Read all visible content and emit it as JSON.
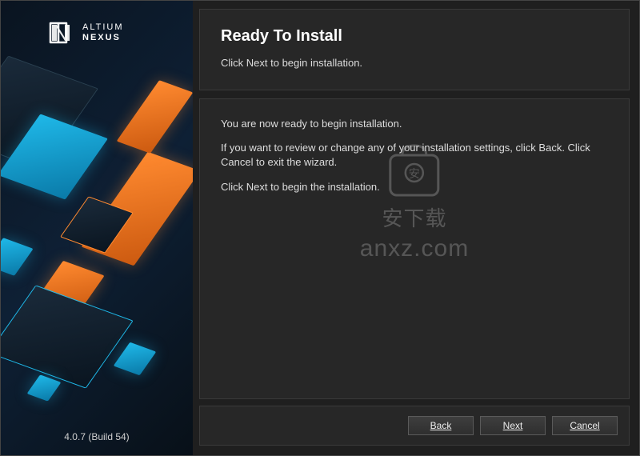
{
  "brand": {
    "line1": "ALTIUM",
    "line2": "NEXUS"
  },
  "version": "4.0.7 (Build 54)",
  "header": {
    "title": "Ready To Install",
    "subtitle": "Click Next to begin installation."
  },
  "body": {
    "p1": "You are now ready to begin installation.",
    "p2": "If you want to review or change any of your installation settings, click Back. Click Cancel to exit the wizard.",
    "p3": "Click Next to begin the installation."
  },
  "watermark": {
    "text": "anxz.com",
    "chars": "安下载"
  },
  "buttons": {
    "back": "Back",
    "next": "Next",
    "cancel": "Cancel"
  }
}
